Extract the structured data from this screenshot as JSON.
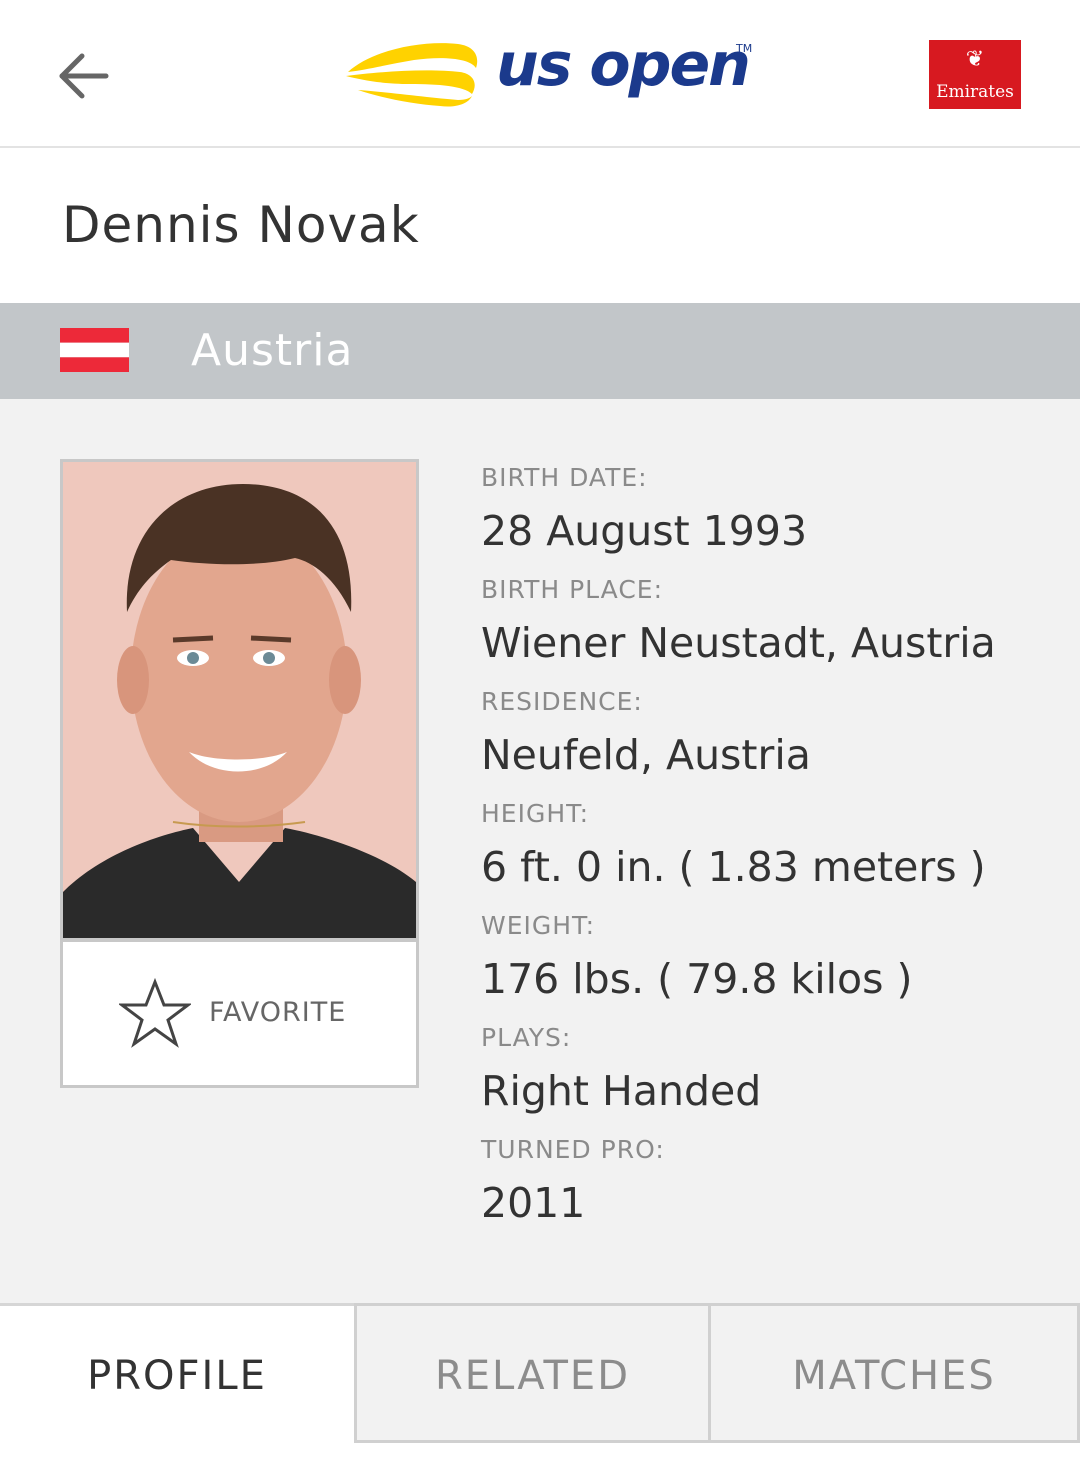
{
  "header": {
    "logo_text": "us open",
    "logo_tm": "TM",
    "sponsor_name": "Emirates",
    "colors": {
      "logo_blue": "#1b3a8c",
      "logo_yellow": "#ffd200",
      "sponsor_red": "#d71920"
    }
  },
  "player": {
    "name": "Dennis Novak",
    "country": "Austria",
    "favorite_label": "FAVORITE"
  },
  "stats": [
    {
      "label": "BIRTH DATE:",
      "value": "28 August 1993"
    },
    {
      "label": "BIRTH PLACE:",
      "value": "Wiener Neustadt, Austria"
    },
    {
      "label": "RESIDENCE:",
      "value": "Neufeld, Austria"
    },
    {
      "label": "HEIGHT:",
      "value": "6 ft. 0 in. ( 1.83 meters )"
    },
    {
      "label": "WEIGHT:",
      "value": "176 lbs. ( 79.8 kilos )"
    },
    {
      "label": "PLAYS:",
      "value": "Right Handed"
    },
    {
      "label": "TURNED PRO:",
      "value": "2011"
    }
  ],
  "tabs": {
    "profile": "PROFILE",
    "related": "RELATED",
    "matches": "MATCHES"
  }
}
